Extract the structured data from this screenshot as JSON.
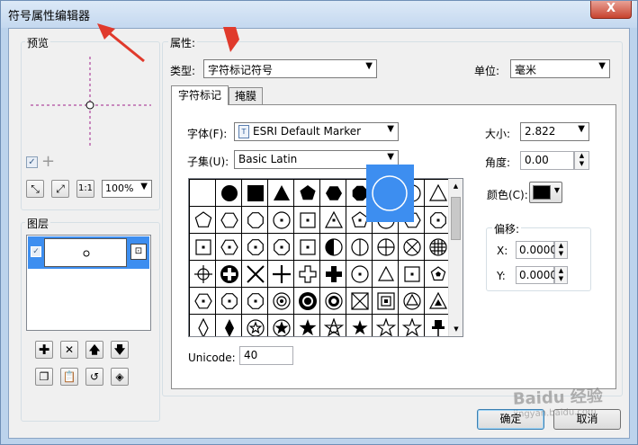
{
  "window": {
    "title": "符号属性编辑器",
    "close_glyph": "X"
  },
  "preview": {
    "group_label": "预览",
    "zoom_value": "100%"
  },
  "layers": {
    "group_label": "图层"
  },
  "properties": {
    "group_label": "属性:",
    "type_label": "类型:",
    "type_value": "字符标记符号",
    "unit_label": "单位:",
    "unit_value": "毫米",
    "tabs": [
      {
        "label": "字符标记"
      },
      {
        "label": "掩膜"
      }
    ],
    "font_label": "字体(F):",
    "font_value": "ESRI Default Marker",
    "subset_label": "子集(U):",
    "subset_value": "Basic Latin",
    "size_label": "大小:",
    "size_value": "2.822",
    "angle_label": "角度:",
    "angle_value": "0.00",
    "color_label": "颜色(C):",
    "color_swatch": "#000000",
    "offset_group_label": "偏移:",
    "offset_x_label": "X:",
    "offset_x_value": "0.0000",
    "offset_y_label": "Y:",
    "offset_y_value": "0.0000",
    "unicode_label": "Unicode:",
    "unicode_value": "40"
  },
  "buttons": {
    "ok_label": "确定",
    "cancel_label": "取消"
  },
  "watermark": {
    "text": "Baidu 经验",
    "sub": "jingyan.baidu.com"
  },
  "accent_color": "#3d8ef0",
  "annotation_color": "#e03a2c"
}
